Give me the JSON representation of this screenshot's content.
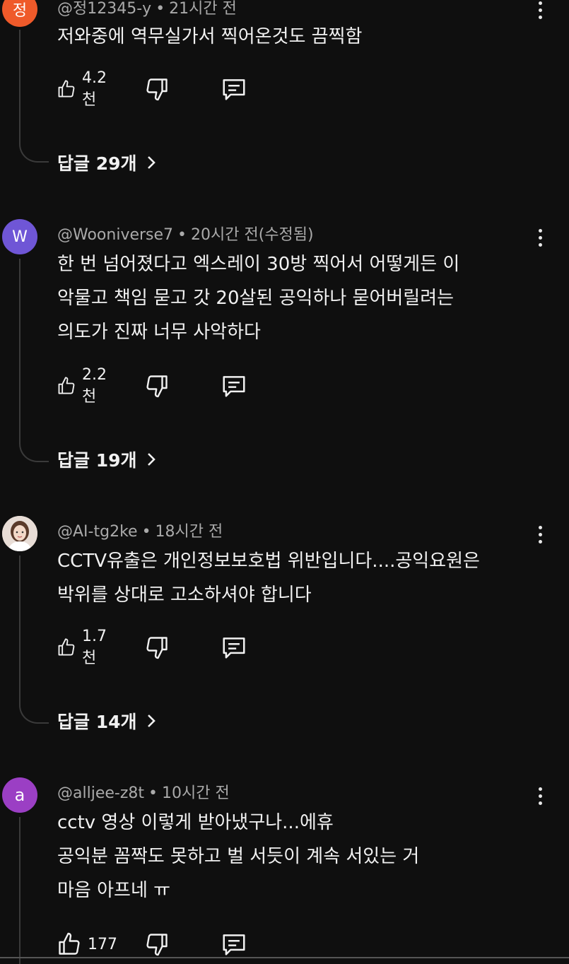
{
  "comments": [
    {
      "avatar_letter": "정",
      "avatar_color": "#ef5a2a",
      "author": "@정12345-y",
      "time": "21시간 전",
      "lines": [
        "저와중에 역무실가서 찍어온것도 끔찍함"
      ],
      "likes": "4.2천",
      "replies": "답글 29개"
    },
    {
      "avatar_letter": "W",
      "avatar_color": "#6f56d6",
      "author": "@Wooniverse7",
      "time": "20시간 전(수정됨)",
      "lines": [
        "한 번 넘어졌다고 엑스레이 30방 찍어서 어떻게든 이",
        "악물고 책임 묻고 갓 20살된 공익하나 묻어버릴려는",
        "의도가 진짜 너무 사악하다"
      ],
      "likes": "2.2천",
      "replies": "답글 19개"
    },
    {
      "avatar_letter": "",
      "avatar_color": "#d9c8c0",
      "author": "@AI-tg2ke",
      "time": "18시간 전",
      "lines": [
        "CCTV유출은 개인정보보호법 위반입니다....공익요원은",
        "박위를 상대로 고소하셔야 합니다"
      ],
      "likes": "1.7천",
      "replies": "답글 14개"
    },
    {
      "avatar_letter": "a",
      "avatar_color": "#9b3fc4",
      "author": "@alljee-z8t",
      "time": "10시간 전",
      "lines": [
        "cctv 영상 이렇게 받아냈구나...에휴",
        "공익분 꼼짝도 못하고 벌 서듯이 계속 서있는 거",
        "마음 아프네 ㅠ"
      ],
      "likes": "177",
      "replies": ""
    }
  ],
  "icons": {
    "like": "thumbs-up-icon",
    "dislike": "thumbs-down-icon",
    "reply": "comment-reply-icon",
    "more": "more-vert-icon",
    "chevron": "chevron-right-icon"
  }
}
